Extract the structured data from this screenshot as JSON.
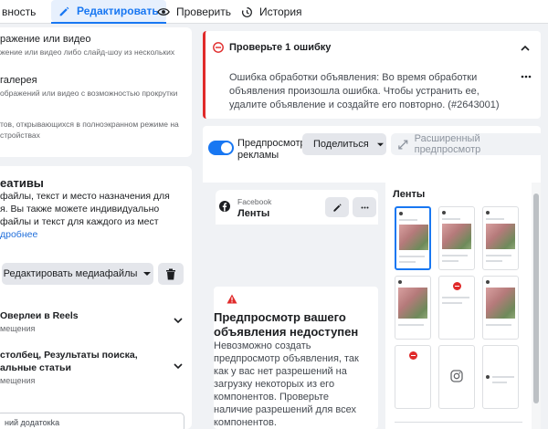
{
  "tabs": [
    {
      "label": "вность"
    },
    {
      "label": "Редактировать"
    },
    {
      "label": "Проверить"
    },
    {
      "label": "История"
    }
  ],
  "left": {
    "options": [
      {
        "title": "ражение или видео",
        "desc": "жение или видео либо слайд-шоу из нескольких"
      },
      {
        "title": "галерея",
        "desc": "ображений или видео с возможностью прокрутки"
      },
      {
        "desc": "тов, открывающихся в полноэкранном режиме на",
        "desc2": "стройствах"
      }
    ],
    "creatives": {
      "title": "еативы",
      "text": [
        "файлы, текст и место назначения для",
        "я. Вы также можете индивидуально",
        "файлы и текст для каждого из мест"
      ],
      "link": "дробнее",
      "edit_media": "Редактировать медиафайлы"
    },
    "placements": [
      {
        "title": "Оверлеи в Reels",
        "sub": "мещения"
      },
      {
        "title": "столбец, Результаты поиска,",
        "title2": "альные статьи",
        "sub": "мещения"
      }
    ],
    "bottom_text": "ний додатокka"
  },
  "error": {
    "title": "Проверьте 1 ошибку",
    "body": "Ошибка обработки объявления: Во время обработки объявления произошла ошибка. Чтобы устранить ее, удалите объявление и создайте его повторно. (#2643001)"
  },
  "preview": {
    "toggle_label": "Предпросмотр рекламы",
    "share": "Поделиться",
    "advanced": "Расширенный предпросмотр",
    "page_source": "Facebook",
    "page_name": "Ленты",
    "unavailable_title": "Предпросмотр вашего объявления недоступен",
    "unavailable_body": "Невозможно создать предпросмотр объявления, так как у вас нет разрешений на загрузку некоторых из его компонентов. Проверьте наличие разрешений для всех компонентов.",
    "feeds_title": "Ленты"
  },
  "colors": {
    "accent": "#1877f2",
    "error": "#e02a2a"
  },
  "icons": [
    "pencil-icon",
    "eye-icon",
    "history-icon",
    "trash-icon",
    "chevron-down-icon",
    "warning-icon",
    "facebook-icon",
    "more-icon",
    "expand-icon",
    "instagram-icon",
    "no-entry-icon"
  ]
}
